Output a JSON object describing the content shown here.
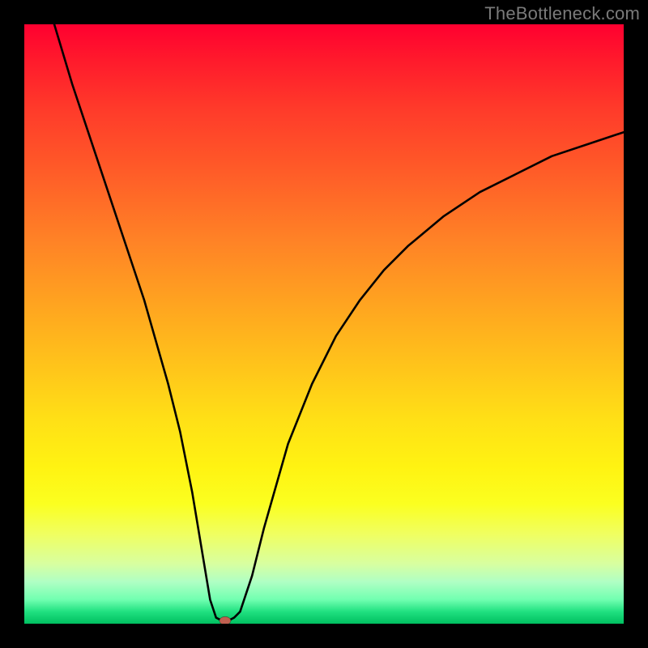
{
  "watermark": "TheBottleneck.com",
  "colors": {
    "frame_bg": "#000000",
    "gradient_top": "#ff0030",
    "gradient_mid": "#ffe016",
    "gradient_bottom": "#00c060",
    "curve": "#000000",
    "dot": "#c06050"
  },
  "chart_data": {
    "type": "line",
    "title": "",
    "xlabel": "",
    "ylabel": "",
    "xlim": [
      0,
      100
    ],
    "ylim": [
      0,
      100
    ],
    "grid": false,
    "legend": false,
    "series": [
      {
        "name": "bottleneck-curve",
        "x": [
          5,
          8,
          12,
          16,
          20,
          24,
          26,
          28,
          30,
          31,
          32,
          33,
          34,
          35,
          36,
          38,
          40,
          44,
          48,
          52,
          56,
          60,
          64,
          70,
          76,
          82,
          88,
          94,
          100
        ],
        "y": [
          100,
          90,
          78,
          66,
          54,
          40,
          32,
          22,
          10,
          4,
          1,
          0.5,
          0.5,
          1,
          2,
          8,
          16,
          30,
          40,
          48,
          54,
          59,
          63,
          68,
          72,
          75,
          78,
          80,
          82
        ]
      }
    ],
    "annotations": [
      {
        "name": "optimal-point",
        "x": 33.5,
        "y": 0.5
      }
    ]
  }
}
